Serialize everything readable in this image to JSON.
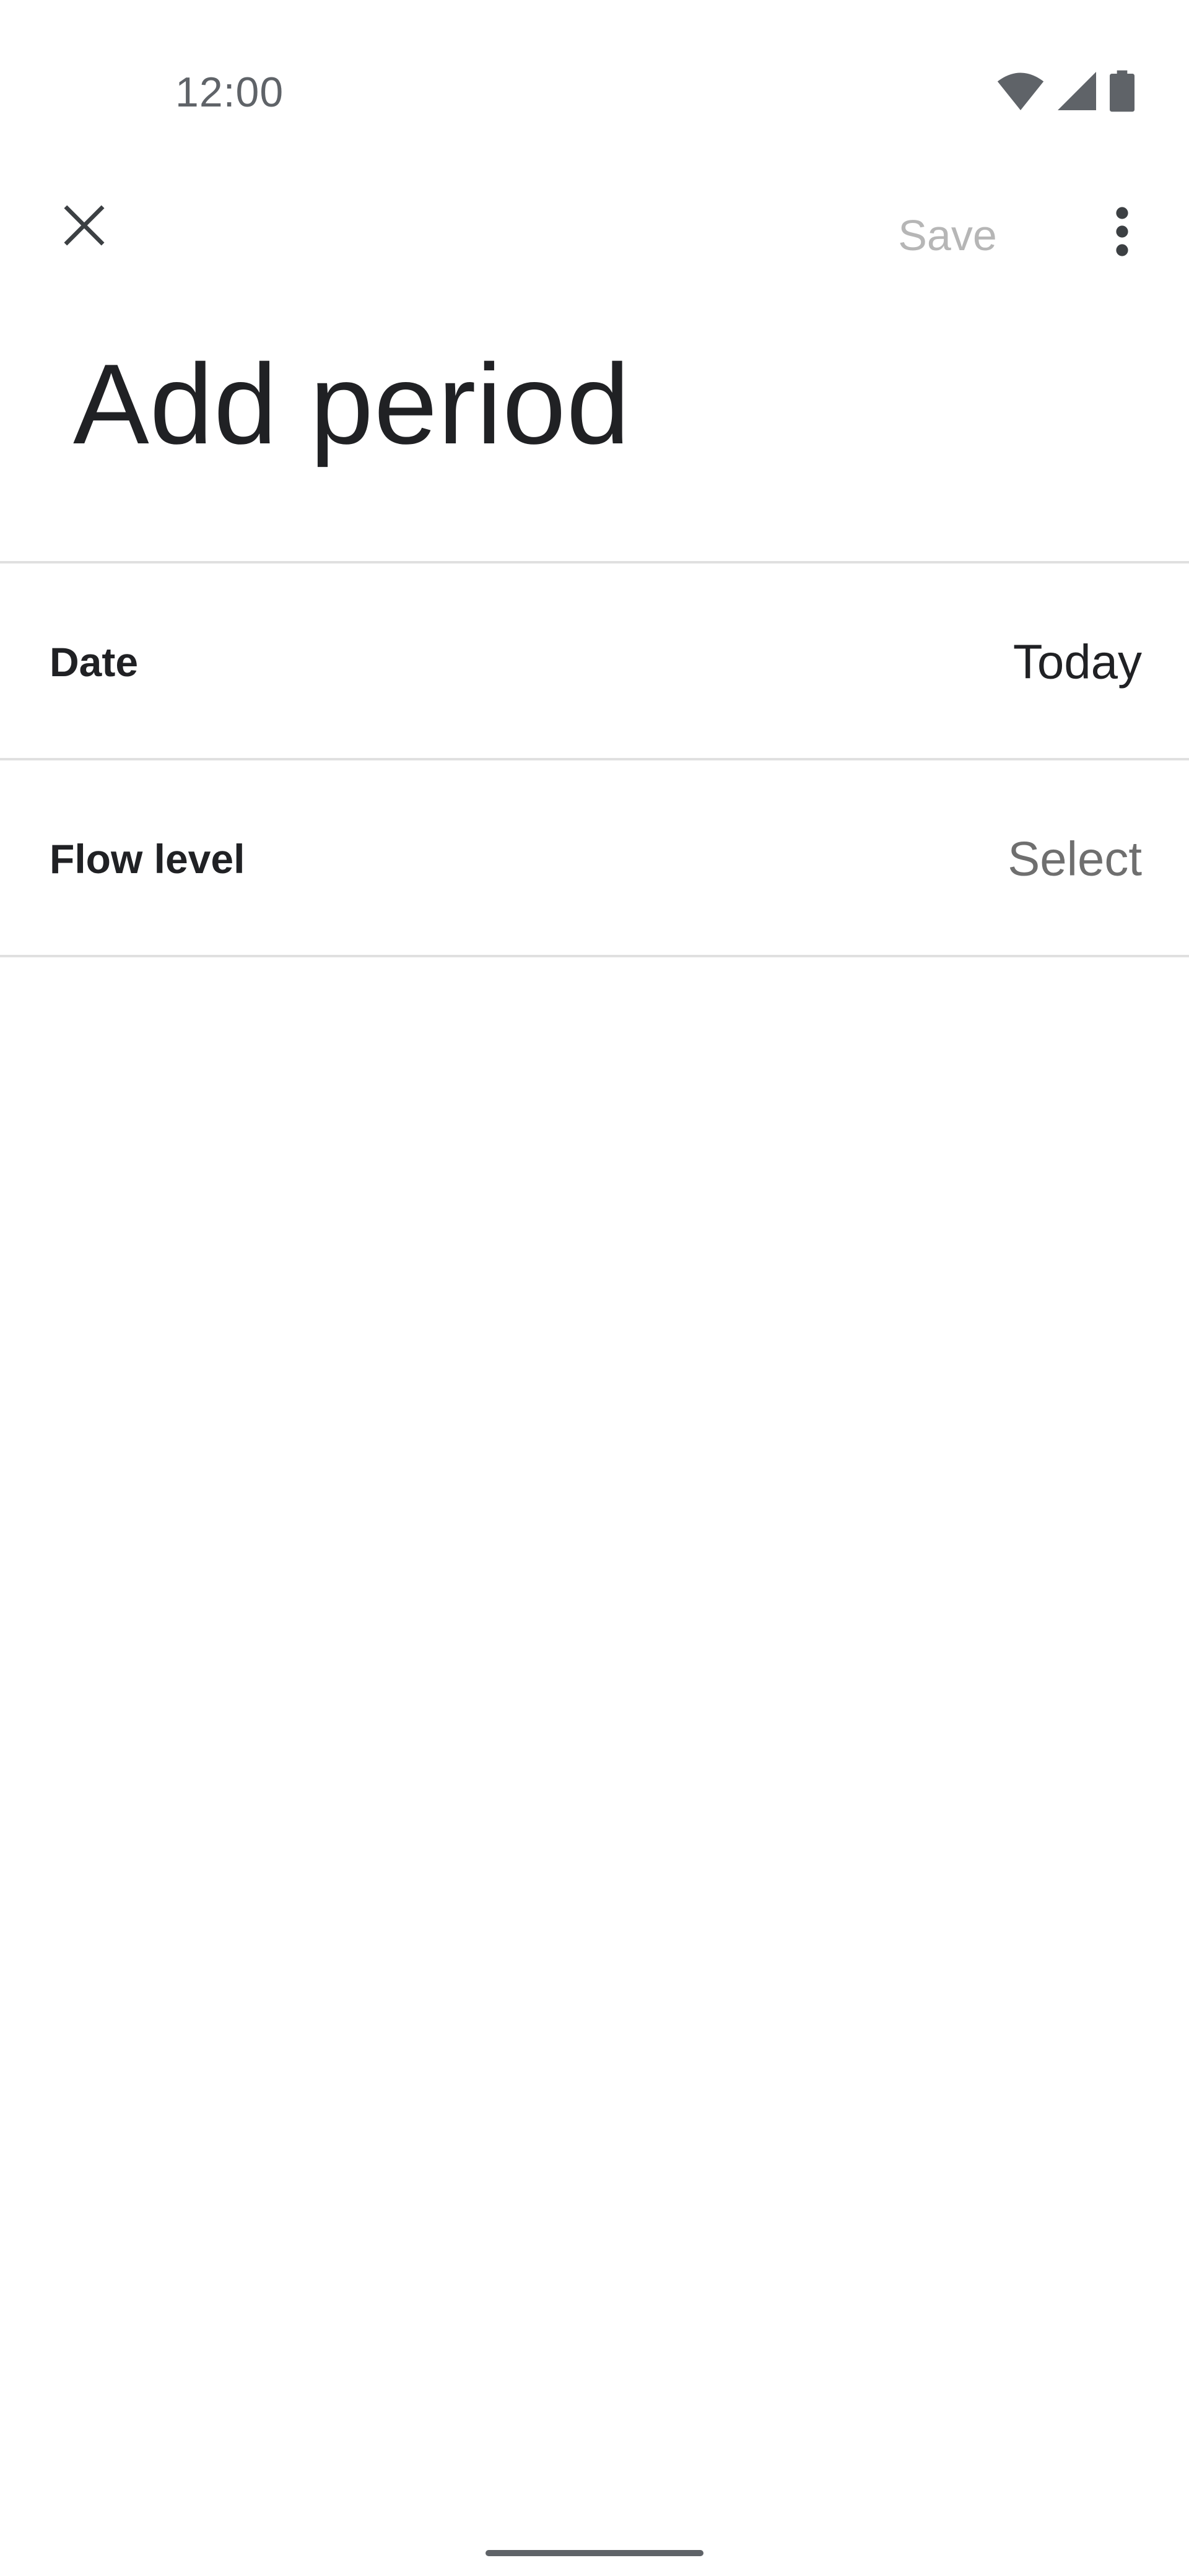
{
  "status_bar": {
    "time": "12:00",
    "icons": [
      "wifi-icon",
      "cellular-signal-icon",
      "battery-icon"
    ]
  },
  "app_bar": {
    "close_icon": "close-icon",
    "save_label": "Save",
    "save_enabled": false,
    "more_icon": "more-vert-icon"
  },
  "page": {
    "title": "Add period"
  },
  "rows": [
    {
      "label": "Date",
      "value": "Today"
    },
    {
      "label": "Flow level",
      "value": "Select"
    }
  ],
  "colors": {
    "text_primary": "#202124",
    "text_secondary": "#6f6f6f",
    "disabled": "#b6b6b6",
    "divider": "#e0e0e0",
    "background": "#ffffff"
  }
}
